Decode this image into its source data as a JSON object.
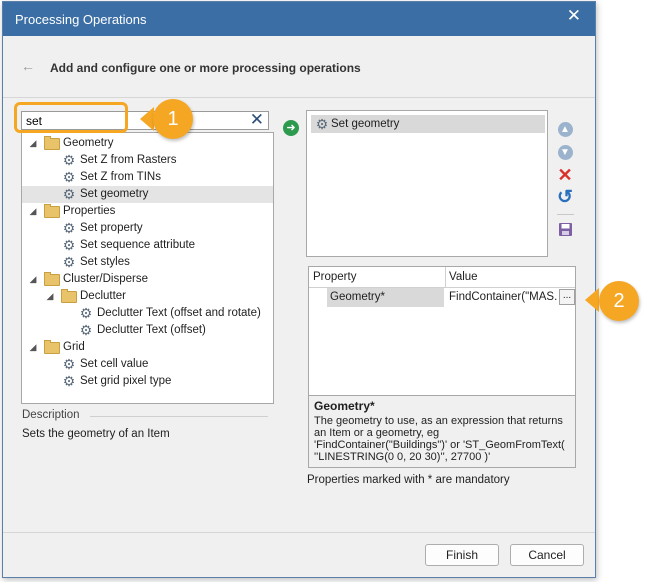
{
  "window": {
    "title": "Processing Operations",
    "close_glyph": "✕"
  },
  "header": {
    "back_glyph": "←",
    "text": "Add and configure one or more processing operations"
  },
  "search": {
    "value": "set",
    "clear_glyph": "✕"
  },
  "callouts": [
    "1",
    "2"
  ],
  "tree": [
    {
      "label": "Geometry",
      "type": "folder",
      "level": 0
    },
    {
      "label": "Set Z from Rasters",
      "type": "operation",
      "level": 1
    },
    {
      "label": "Set Z from TINs",
      "type": "operation",
      "level": 1
    },
    {
      "label": "Set geometry",
      "type": "operation",
      "level": 1,
      "selected": true
    },
    {
      "label": "Properties",
      "type": "folder",
      "level": 0
    },
    {
      "label": "Set property",
      "type": "operation",
      "level": 1
    },
    {
      "label": "Set sequence attribute",
      "type": "operation",
      "level": 1
    },
    {
      "label": "Set styles",
      "type": "operation",
      "level": 1
    },
    {
      "label": "Cluster/Disperse",
      "type": "folder",
      "level": 0
    },
    {
      "label": "Declutter",
      "type": "folder",
      "level": 1
    },
    {
      "label": "Declutter Text (offset and rotate)",
      "type": "operation",
      "level": 2
    },
    {
      "label": "Declutter Text (offset)",
      "type": "operation",
      "level": 2
    },
    {
      "label": "Grid",
      "type": "folder",
      "level": 0
    },
    {
      "label": "Set cell value",
      "type": "operation",
      "level": 1
    },
    {
      "label": "Set grid pixel type",
      "type": "operation",
      "level": 1
    }
  ],
  "description": {
    "title": "Description",
    "text": "Sets the geometry of an Item"
  },
  "selected_operations": [
    "Set geometry"
  ],
  "property_grid": {
    "col_property": "Property",
    "col_value": "Value",
    "rows": [
      {
        "property": "Geometry*",
        "value": "FindContainer(\"MAS..."
      }
    ],
    "ellipsis": "..."
  },
  "help": {
    "title": "Geometry*",
    "text": "The geometry to use, as an expression that returns an Item or a geometry, eg 'FindContainer(\"Buildings\")' or 'ST_GeomFromText( ''LINESTRING(0 0, 20 30)'', 27700 )'"
  },
  "mandatory_note": "Properties marked with * are mandatory",
  "buttons": {
    "finish": "Finish",
    "cancel": "Cancel"
  },
  "colors": {
    "titlebar": "#3b6ea5",
    "callout": "#f5a623",
    "add": "#2e9a4e",
    "delete": "#d9322b",
    "reset": "#2a6fbd"
  }
}
